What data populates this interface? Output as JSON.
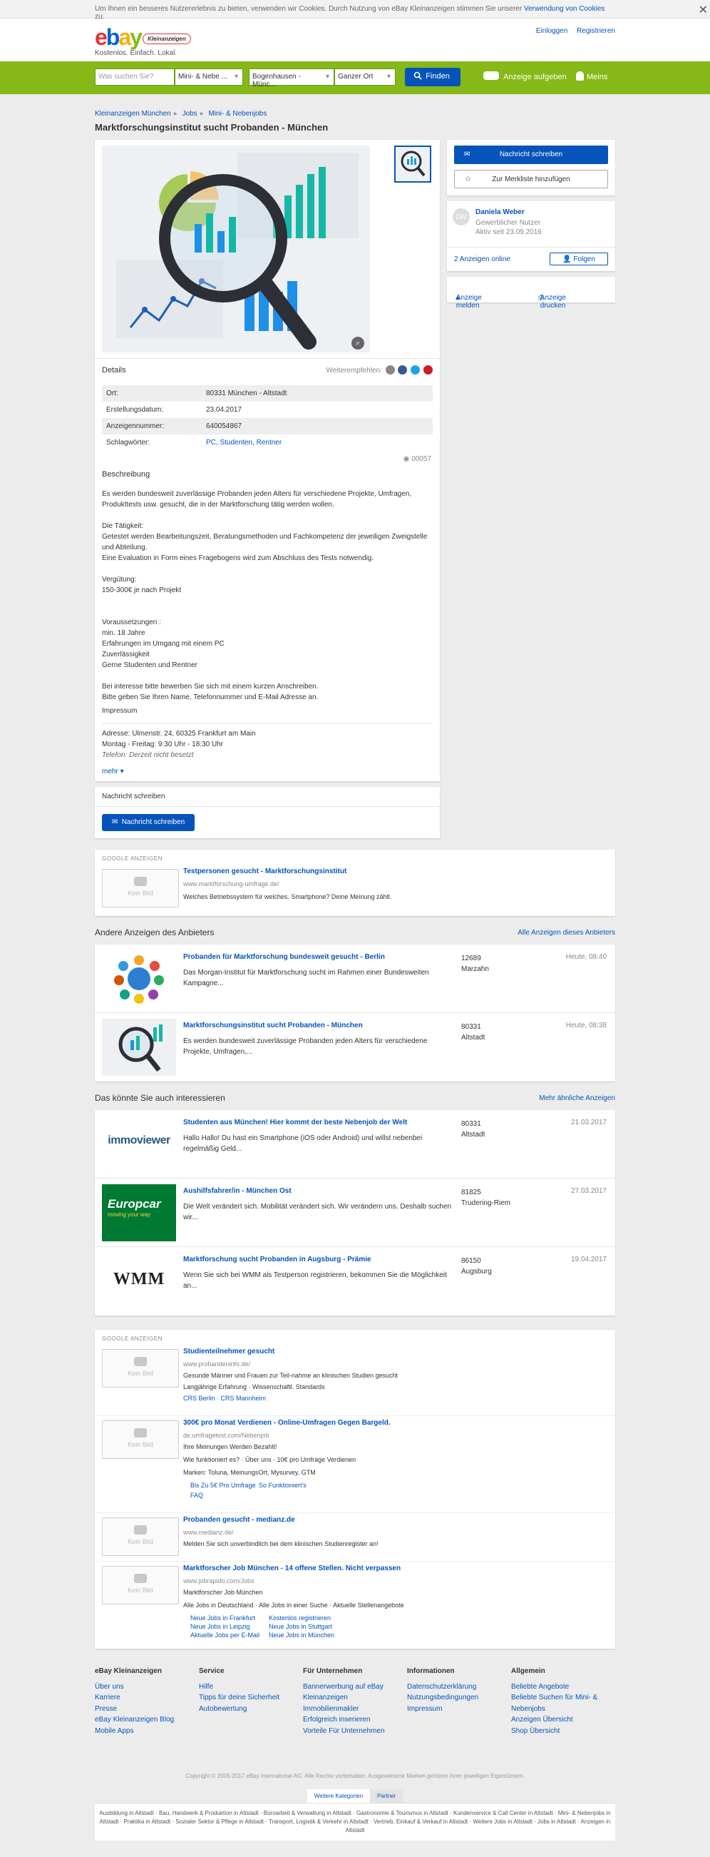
{
  "cookie": {
    "text": "Um Ihnen ein besseres Nutzererlebnis zu bieten, verwenden wir Cookies. Durch Nutzung von eBay Kleinanzeigen stimmen Sie unserer",
    "link": "Verwendung von Cookies",
    "suffix": "zu."
  },
  "header": {
    "logo_e": "e",
    "logo_b": "b",
    "logo_a": "a",
    "logo_y": "y",
    "logo_badge": "Kleinanzeigen",
    "tagline": "Kostenlos. Einfach. Lokal.",
    "login": "Einloggen",
    "register": "Registrieren"
  },
  "search": {
    "placeholder": "Was suchen Sie?",
    "category": "Mini- & Nebe ...",
    "location": "Bogenhausen - Münc...",
    "radius": "Ganzer Ort",
    "find": "Finden",
    "post_ad": "Anzeige aufgeben",
    "mine": "Meins"
  },
  "breadcrumb": [
    "Kleinanzeigen München",
    "Jobs",
    "Mini- & Nebenjobs"
  ],
  "title": "Marktforschungsinstitut sucht Probanden - München",
  "details": {
    "label": "Details",
    "share_label": "Weiterempfehlen:",
    "attributes": [
      {
        "k": "Ort:",
        "v": "80331 München - Altstadt"
      },
      {
        "k": "Erstellungsdatum:",
        "v": "23.04.2017"
      },
      {
        "k": "Anzeigennummer:",
        "v": "640054867"
      },
      {
        "k": "Schlagwörter:",
        "v": "PC, Studenten, Rentner"
      }
    ],
    "views": "00057"
  },
  "description": {
    "heading": "Beschreibung",
    "lines": [
      "Es werden bundesweit zuverlässige Probanden jeden Alters für verschiedene Projekte, Umfragen,",
      "Produkttests usw. gesucht, die in der Marktforschung tätig werden wollen.",
      "",
      "Die Tätigkeit:",
      "Getestet werden Bearbeitungszeit, Beratungsmethoden und Fachkompetenz der jeweiligen Zweigstelle",
      "und Abteilung.",
      "Eine Evaluation in Form eines Fragebogens wird zum Abschluss des Tests notwendig.",
      "",
      "Vergütung:",
      "150-300€ je nach Projekt",
      "",
      "",
      "Voraussetzungen :",
      "min. 18 Jahre",
      "Erfahrungen im Umgang mit einem PC",
      "Zuverlässigkeit",
      "Gerne Studenten und Rentner",
      "",
      "Bei interesse bitte bewerben Sie sich mit einem kurzen Anschreiben.",
      "Bitte geben Sie Ihren Name, Telefonnummer und E-Mail Adresse an."
    ],
    "impressum_heading": "Impressum",
    "impressum_lines": [
      "Adresse: Ulmenstr. 24, 60325 Frankfurt am Main",
      "Montag - Freitag: 9:30 Uhr - 18:30 Uhr",
      "Telefon: Derzeit nicht besetzt"
    ],
    "more": "mehr"
  },
  "message_box": {
    "heading": "Nachricht schreiben",
    "button": "Nachricht schreiben"
  },
  "sidebar": {
    "write_message": "Nachricht schreiben",
    "watchlist": "Zur Merkliste hinzufügen",
    "user_initials": "DW",
    "user_name": "Daniela Weber",
    "user_type": "Gewerblicher Nutzer",
    "user_since": "Aktiv seit 23.09.2016",
    "ads_online": "2 Anzeigen online",
    "follow": "Folgen",
    "report": "Anzeige melden",
    "print": "Anzeige drucken"
  },
  "google_ads_1": {
    "label": "GOOGLE ANZEIGEN",
    "no_image": "Kein Bild",
    "title": "Testpersonen gesucht - Marktforschungsinstitut",
    "url": "www.marktforschung-umfrage.de/",
    "text": "Welches Betriebssystem für welches. Smartphone? Deine Meinung zählt."
  },
  "other_ads": {
    "heading": "Andere Anzeigen des Anbieters",
    "all_link": "Alle Anzeigen dieses Anbieters",
    "items": [
      {
        "title": "Probanden für Marktforschung bundesweit gesucht - Berlin",
        "desc": "Das Morgan-Institut für Marktforschung sucht im Rahmen einer Bundesweiten Kampagne...",
        "zip": "12689",
        "place": "Marzahn",
        "date": "Heute, 08:40"
      },
      {
        "title": "Marktforschungsinstitut sucht Probanden - München",
        "desc": "Es werden bundesweit zuverlässige Probanden jeden Alters für verschiedene Projekte, Umfragen,...",
        "zip": "80331",
        "place": "Altstadt",
        "date": "Heute, 08:38"
      }
    ]
  },
  "similar": {
    "heading": "Das könnte Sie auch interessieren",
    "more_link": "Mehr ähnliche Anzeigen",
    "items": [
      {
        "title": "Studenten aus München! Hier kommt der beste Nebenjob der Welt",
        "desc": "Hallo Hallo! Du hast ein Smartphone (iOS oder Android) und willst nebenbei regelmäßig Geld...",
        "zip": "80331",
        "place": "Altstadt",
        "date": "21.03.2017",
        "logo": "immoviewer"
      },
      {
        "title": "Aushilfsfahrer/in - München Ost",
        "desc": "Die Welt verändert sich. Mobilität verändert sich. Wir verändern uns. Deshalb suchen wir...",
        "zip": "81825",
        "place": "Trudering-Riem",
        "date": "27.03.2017",
        "logo": "Europcar",
        "logo_sub": "moving your way"
      },
      {
        "title": "Marktforschung sucht Probanden in Augsburg - Prämie",
        "desc": "Wenn Sie sich bei WMM als Testperson registrieren, bekommen Sie die Möglichkeit an...",
        "zip": "86150",
        "place": "Augsburg",
        "date": "19.04.2017",
        "logo": "WMM"
      }
    ]
  },
  "google_ads_2": {
    "label": "GOOGLE ANZEIGEN",
    "no_image": "Kein Bild",
    "ads": [
      {
        "title": "Studienteilnehmer gesucht",
        "url": "www.probandeninfo.de/",
        "lines": [
          "Gesunde Männer und Frauen zur Teil-nahme an klinischen Studien gesucht",
          "Langjährige Erfahrung · Wissenschaftl. Standards"
        ],
        "links": [
          "CRS Berlin · CRS Mannheim"
        ]
      },
      {
        "title": "300€ pro Monat Verdienen - Online-Umfragen Gegen Bargeld.",
        "url": "de.umfragetest.com/Nebenjob",
        "lines": [
          "Ihre Meinungen Werden Bezahlt!",
          "Wie funktioniert es? · Über uns · 10€ pro Umfrage Verdienen",
          "Marken: Toluna, MeinungsOrt, Mysurvey, GTM"
        ],
        "links": [
          "Bis Zu 5€ Pro Umfrage",
          "So Funktioniert's",
          "FAQ"
        ]
      },
      {
        "title": "Probanden gesucht - medianz.de",
        "url": "www.medianz.de/",
        "lines": [
          "Melden Sie sich unverbindlich bei dem klinischen Studienregister an!"
        ],
        "links": []
      },
      {
        "title": "Marktforscher Job München - 14 offene Stellen. Nicht verpassen",
        "url": "www.jobrapido.com/Jobs",
        "lines": [
          "Marktforscher Job München",
          "Alle Jobs in Deutschland · Alle Jobs in einer Suche · Aktuelle Stellenangebote"
        ],
        "links": [
          "Neue Jobs in Frankfurt",
          "Kostenlos registrieren",
          "Neue Jobs in Leipzig",
          "Neue Jobs in Stuttgart",
          "Aktuelle Jobs per E-Mail",
          "Neue Jobs in München"
        ]
      }
    ]
  },
  "footer": {
    "cols": [
      {
        "h": "eBay Kleinanzeigen",
        "links": [
          "Über uns",
          "Karriere",
          "Presse",
          "eBay Kleinanzeigen Blog",
          "Mobile Apps"
        ]
      },
      {
        "h": "Service",
        "links": [
          "Hilfe",
          "Tipps für deine Sicherheit",
          "Autobewertung"
        ]
      },
      {
        "h": "Für Unternehmen",
        "links": [
          "Bannerwerbung auf eBay",
          "Kleinanzeigen",
          "Immobilienmakler",
          "Erfolgreich inserieren",
          "Vorteile Für Unternehmen"
        ]
      },
      {
        "h": "Informationen",
        "links": [
          "Datenschutzerklärung",
          "Nutzungsbedingungen",
          "Impressum"
        ]
      },
      {
        "h": "Allgemein",
        "links": [
          "Beliebte Angebote",
          "Beliebte Suchen für Mini- &",
          "Nebenjobs",
          "Anzeigen Übersicht",
          "Shop Übersicht"
        ]
      }
    ],
    "copyright": "Copyright © 2005-2017 eBay International AG. Alle Rechte vorbehalten. Ausgewiesene Marken gehören ihren jeweiligen Eigentümern.",
    "tab_more": "Weitere Kategorien",
    "tab_partner": "Partner",
    "seo": "Ausbildung in Altstadt · Bau, Handwerk & Produktion in Altstadt · Büroarbeit & Verwaltung in Altstadt · Gastronomie & Tourismus in Altstadt · Kundenservice & Call Center in Altstadt · Mini- & Nebenjobs in Altstadt · Praktika in Altstadt · Sozialer Sektor & Pflege in Altstadt · Transport, Logistik & Verkehr in Altstadt · Vertrieb, Einkauf & Verkauf in Altstadt · Weitere Jobs in Altstadt · Jobs in Altstadt · Anzeigen in Altstadt"
  }
}
